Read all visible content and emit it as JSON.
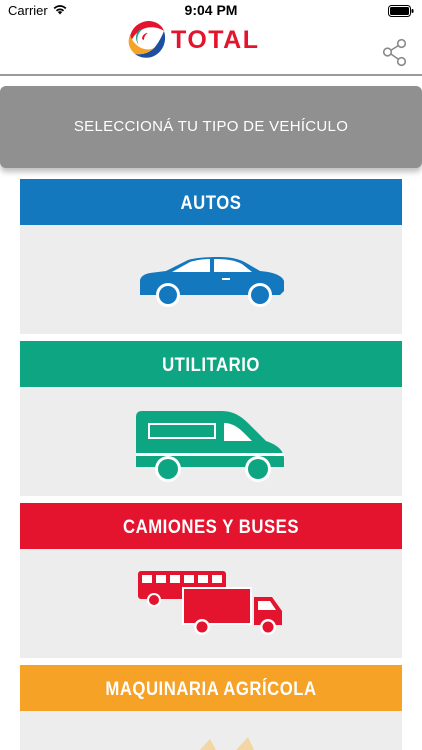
{
  "status_bar": {
    "carrier": "Carrier",
    "time": "9:04 PM"
  },
  "header": {
    "logo_text": "TOTAL",
    "share_icon": "share-icon"
  },
  "banner": {
    "text": "SELECCIONÁ TU TIPO DE VEHÍCULO"
  },
  "vehicle_types": [
    {
      "label": "AUTOS",
      "color": "#1378be",
      "icon": "car-icon"
    },
    {
      "label": "UTILITARIO",
      "color": "#0ea682",
      "icon": "van-icon"
    },
    {
      "label": "CAMIONES Y BUSES",
      "color": "#e4142e",
      "icon": "truck-bus-icon"
    },
    {
      "label": "MAQUINARIA AGRÍCOLA",
      "color": "#f5a227",
      "icon": "agricultural-machinery-icon"
    }
  ],
  "colors": {
    "banner_bg": "#909090",
    "card_bg": "#ededed",
    "logo_red": "#e4142e"
  }
}
